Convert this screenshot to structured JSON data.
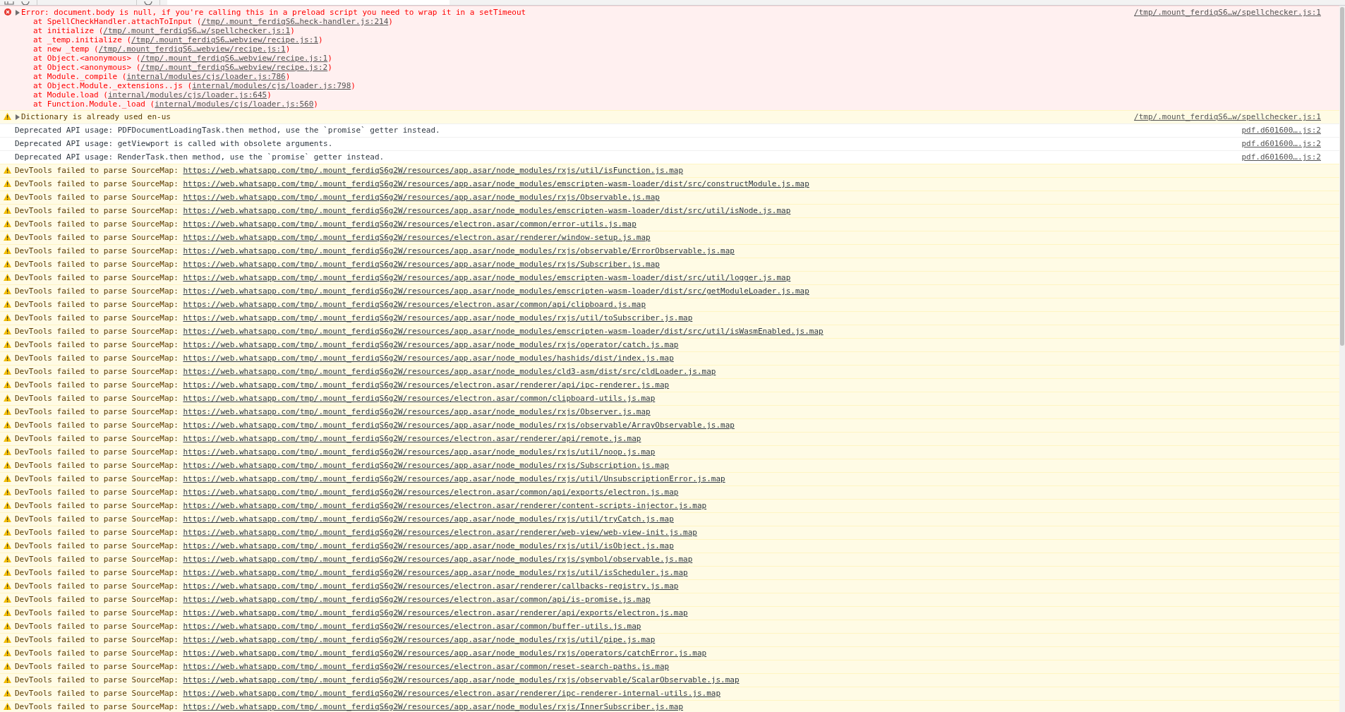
{
  "messages": [
    {
      "kind": "error",
      "expanded": false,
      "text": "Error: document.body is null, if you're calling this in a preload script you need to wrap it in a setTimeout",
      "source": "/tmp/.mount_ferdiqS6…w/spellchecker.js:1",
      "stack": [
        {
          "call": "at SpellCheckHandler.attachToInput (",
          "link": "/tmp/.mount_ferdiqS6…heck-handler.js:214",
          "close": ")"
        },
        {
          "call": "at initialize (",
          "link": "/tmp/.mount_ferdiqS6…w/spellchecker.js:1",
          "close": ")"
        },
        {
          "call": "at _temp.initialize (",
          "link": "/tmp/.mount_ferdiqS6…webview/recipe.js:1",
          "close": ")"
        },
        {
          "call": "at new _temp (",
          "link": "/tmp/.mount_ferdiqS6…webview/recipe.js:1",
          "close": ")"
        },
        {
          "call": "at Object.<anonymous> (",
          "link": "/tmp/.mount_ferdiqS6…webview/recipe.js:1",
          "close": ")"
        },
        {
          "call": "at Object.<anonymous> (",
          "link": "/tmp/.mount_ferdiqS6…webview/recipe.js:2",
          "close": ")"
        },
        {
          "call": "at Module._compile (",
          "link": "internal/modules/cjs/loader.js:786",
          "close": ")"
        },
        {
          "call": "at Object.Module._extensions..js (",
          "link": "internal/modules/cjs/loader.js:798",
          "close": ")"
        },
        {
          "call": "at Module.load (",
          "link": "internal/modules/cjs/loader.js:645",
          "close": ")"
        },
        {
          "call": "at Function.Module._load (",
          "link": "internal/modules/cjs/loader.js:560",
          "close": ")"
        }
      ]
    },
    {
      "kind": "warning",
      "expanded": false,
      "text": "Dictionary is already used en-us",
      "source": "/tmp/.mount_ferdiqS6…w/spellchecker.js:1"
    },
    {
      "kind": "log",
      "text": "Deprecated API usage: PDFDocumentLoadingTask.then method, use the `promise` getter instead.",
      "source": "pdf.d601600….js:2"
    },
    {
      "kind": "log",
      "text": "Deprecated API usage: getViewport is called with obsolete arguments.",
      "source": "pdf.d601600….js:2"
    },
    {
      "kind": "log",
      "text": "Deprecated API usage: RenderTask.then method, use the `promise` getter instead.",
      "source": "pdf.d601600….js:2"
    },
    {
      "kind": "sourcemap",
      "text": "DevTools failed to parse SourceMap:",
      "url": "https://web.whatsapp.com/tmp/.mount_ferdiqS6g2W/resources/app.asar/node_modules/rxjs/util/isFunction.js.map"
    },
    {
      "kind": "sourcemap",
      "text": "DevTools failed to parse SourceMap:",
      "url": "https://web.whatsapp.com/tmp/.mount_ferdiqS6g2W/resources/app.asar/node_modules/emscripten-wasm-loader/dist/src/constructModule.js.map"
    },
    {
      "kind": "sourcemap",
      "text": "DevTools failed to parse SourceMap:",
      "url": "https://web.whatsapp.com/tmp/.mount_ferdiqS6g2W/resources/app.asar/node_modules/rxjs/Observable.js.map"
    },
    {
      "kind": "sourcemap",
      "text": "DevTools failed to parse SourceMap:",
      "url": "https://web.whatsapp.com/tmp/.mount_ferdiqS6g2W/resources/app.asar/node_modules/emscripten-wasm-loader/dist/src/util/isNode.js.map"
    },
    {
      "kind": "sourcemap",
      "text": "DevTools failed to parse SourceMap:",
      "url": "https://web.whatsapp.com/tmp/.mount_ferdiqS6g2W/resources/electron.asar/common/error-utils.js.map"
    },
    {
      "kind": "sourcemap",
      "text": "DevTools failed to parse SourceMap:",
      "url": "https://web.whatsapp.com/tmp/.mount_ferdiqS6g2W/resources/electron.asar/renderer/window-setup.js.map"
    },
    {
      "kind": "sourcemap",
      "text": "DevTools failed to parse SourceMap:",
      "url": "https://web.whatsapp.com/tmp/.mount_ferdiqS6g2W/resources/app.asar/node_modules/rxjs/observable/ErrorObservable.js.map"
    },
    {
      "kind": "sourcemap",
      "text": "DevTools failed to parse SourceMap:",
      "url": "https://web.whatsapp.com/tmp/.mount_ferdiqS6g2W/resources/app.asar/node_modules/rxjs/Subscriber.js.map"
    },
    {
      "kind": "sourcemap",
      "text": "DevTools failed to parse SourceMap:",
      "url": "https://web.whatsapp.com/tmp/.mount_ferdiqS6g2W/resources/app.asar/node_modules/emscripten-wasm-loader/dist/src/util/logger.js.map"
    },
    {
      "kind": "sourcemap",
      "text": "DevTools failed to parse SourceMap:",
      "url": "https://web.whatsapp.com/tmp/.mount_ferdiqS6g2W/resources/app.asar/node_modules/emscripten-wasm-loader/dist/src/getModuleLoader.js.map"
    },
    {
      "kind": "sourcemap",
      "text": "DevTools failed to parse SourceMap:",
      "url": "https://web.whatsapp.com/tmp/.mount_ferdiqS6g2W/resources/electron.asar/common/api/clipboard.js.map"
    },
    {
      "kind": "sourcemap",
      "text": "DevTools failed to parse SourceMap:",
      "url": "https://web.whatsapp.com/tmp/.mount_ferdiqS6g2W/resources/app.asar/node_modules/rxjs/util/toSubscriber.js.map"
    },
    {
      "kind": "sourcemap",
      "text": "DevTools failed to parse SourceMap:",
      "url": "https://web.whatsapp.com/tmp/.mount_ferdiqS6g2W/resources/app.asar/node_modules/emscripten-wasm-loader/dist/src/util/isWasmEnabled.js.map"
    },
    {
      "kind": "sourcemap",
      "text": "DevTools failed to parse SourceMap:",
      "url": "https://web.whatsapp.com/tmp/.mount_ferdiqS6g2W/resources/app.asar/node_modules/rxjs/operator/catch.js.map"
    },
    {
      "kind": "sourcemap",
      "text": "DevTools failed to parse SourceMap:",
      "url": "https://web.whatsapp.com/tmp/.mount_ferdiqS6g2W/resources/app.asar/node_modules/hashids/dist/index.js.map"
    },
    {
      "kind": "sourcemap",
      "text": "DevTools failed to parse SourceMap:",
      "url": "https://web.whatsapp.com/tmp/.mount_ferdiqS6g2W/resources/app.asar/node_modules/cld3-asm/dist/src/cldLoader.js.map"
    },
    {
      "kind": "sourcemap",
      "text": "DevTools failed to parse SourceMap:",
      "url": "https://web.whatsapp.com/tmp/.mount_ferdiqS6g2W/resources/electron.asar/renderer/api/ipc-renderer.js.map"
    },
    {
      "kind": "sourcemap",
      "text": "DevTools failed to parse SourceMap:",
      "url": "https://web.whatsapp.com/tmp/.mount_ferdiqS6g2W/resources/electron.asar/common/clipboard-utils.js.map"
    },
    {
      "kind": "sourcemap",
      "text": "DevTools failed to parse SourceMap:",
      "url": "https://web.whatsapp.com/tmp/.mount_ferdiqS6g2W/resources/app.asar/node_modules/rxjs/Observer.js.map"
    },
    {
      "kind": "sourcemap",
      "text": "DevTools failed to parse SourceMap:",
      "url": "https://web.whatsapp.com/tmp/.mount_ferdiqS6g2W/resources/app.asar/node_modules/rxjs/observable/ArrayObservable.js.map"
    },
    {
      "kind": "sourcemap",
      "text": "DevTools failed to parse SourceMap:",
      "url": "https://web.whatsapp.com/tmp/.mount_ferdiqS6g2W/resources/electron.asar/renderer/api/remote.js.map"
    },
    {
      "kind": "sourcemap",
      "text": "DevTools failed to parse SourceMap:",
      "url": "https://web.whatsapp.com/tmp/.mount_ferdiqS6g2W/resources/app.asar/node_modules/rxjs/util/noop.js.map"
    },
    {
      "kind": "sourcemap",
      "text": "DevTools failed to parse SourceMap:",
      "url": "https://web.whatsapp.com/tmp/.mount_ferdiqS6g2W/resources/app.asar/node_modules/rxjs/Subscription.js.map"
    },
    {
      "kind": "sourcemap",
      "text": "DevTools failed to parse SourceMap:",
      "url": "https://web.whatsapp.com/tmp/.mount_ferdiqS6g2W/resources/app.asar/node_modules/rxjs/util/UnsubscriptionError.js.map"
    },
    {
      "kind": "sourcemap",
      "text": "DevTools failed to parse SourceMap:",
      "url": "https://web.whatsapp.com/tmp/.mount_ferdiqS6g2W/resources/electron.asar/common/api/exports/electron.js.map"
    },
    {
      "kind": "sourcemap",
      "text": "DevTools failed to parse SourceMap:",
      "url": "https://web.whatsapp.com/tmp/.mount_ferdiqS6g2W/resources/electron.asar/renderer/content-scripts-injector.js.map"
    },
    {
      "kind": "sourcemap",
      "text": "DevTools failed to parse SourceMap:",
      "url": "https://web.whatsapp.com/tmp/.mount_ferdiqS6g2W/resources/app.asar/node_modules/rxjs/util/tryCatch.js.map"
    },
    {
      "kind": "sourcemap",
      "text": "DevTools failed to parse SourceMap:",
      "url": "https://web.whatsapp.com/tmp/.mount_ferdiqS6g2W/resources/electron.asar/renderer/web-view/web-view-init.js.map"
    },
    {
      "kind": "sourcemap",
      "text": "DevTools failed to parse SourceMap:",
      "url": "https://web.whatsapp.com/tmp/.mount_ferdiqS6g2W/resources/app.asar/node_modules/rxjs/util/isObject.js.map"
    },
    {
      "kind": "sourcemap",
      "text": "DevTools failed to parse SourceMap:",
      "url": "https://web.whatsapp.com/tmp/.mount_ferdiqS6g2W/resources/app.asar/node_modules/rxjs/symbol/observable.js.map"
    },
    {
      "kind": "sourcemap",
      "text": "DevTools failed to parse SourceMap:",
      "url": "https://web.whatsapp.com/tmp/.mount_ferdiqS6g2W/resources/app.asar/node_modules/rxjs/util/isScheduler.js.map"
    },
    {
      "kind": "sourcemap",
      "text": "DevTools failed to parse SourceMap:",
      "url": "https://web.whatsapp.com/tmp/.mount_ferdiqS6g2W/resources/electron.asar/renderer/callbacks-registry.js.map"
    },
    {
      "kind": "sourcemap",
      "text": "DevTools failed to parse SourceMap:",
      "url": "https://web.whatsapp.com/tmp/.mount_ferdiqS6g2W/resources/electron.asar/common/api/is-promise.js.map"
    },
    {
      "kind": "sourcemap",
      "text": "DevTools failed to parse SourceMap:",
      "url": "https://web.whatsapp.com/tmp/.mount_ferdiqS6g2W/resources/electron.asar/renderer/api/exports/electron.js.map"
    },
    {
      "kind": "sourcemap",
      "text": "DevTools failed to parse SourceMap:",
      "url": "https://web.whatsapp.com/tmp/.mount_ferdiqS6g2W/resources/electron.asar/common/buffer-utils.js.map"
    },
    {
      "kind": "sourcemap",
      "text": "DevTools failed to parse SourceMap:",
      "url": "https://web.whatsapp.com/tmp/.mount_ferdiqS6g2W/resources/app.asar/node_modules/rxjs/util/pipe.js.map"
    },
    {
      "kind": "sourcemap",
      "text": "DevTools failed to parse SourceMap:",
      "url": "https://web.whatsapp.com/tmp/.mount_ferdiqS6g2W/resources/app.asar/node_modules/rxjs/operators/catchError.js.map"
    },
    {
      "kind": "sourcemap",
      "text": "DevTools failed to parse SourceMap:",
      "url": "https://web.whatsapp.com/tmp/.mount_ferdiqS6g2W/resources/electron.asar/common/reset-search-paths.js.map"
    },
    {
      "kind": "sourcemap",
      "text": "DevTools failed to parse SourceMap:",
      "url": "https://web.whatsapp.com/tmp/.mount_ferdiqS6g2W/resources/app.asar/node_modules/rxjs/observable/ScalarObservable.js.map"
    },
    {
      "kind": "sourcemap",
      "text": "DevTools failed to parse SourceMap:",
      "url": "https://web.whatsapp.com/tmp/.mount_ferdiqS6g2W/resources/electron.asar/renderer/ipc-renderer-internal-utils.js.map"
    },
    {
      "kind": "sourcemap",
      "text": "DevTools failed to parse SourceMap:",
      "url": "https://web.whatsapp.com/tmp/.mount_ferdiqS6g2W/resources/app.asar/node_modules/rxjs/InnerSubscriber.js.map"
    }
  ]
}
